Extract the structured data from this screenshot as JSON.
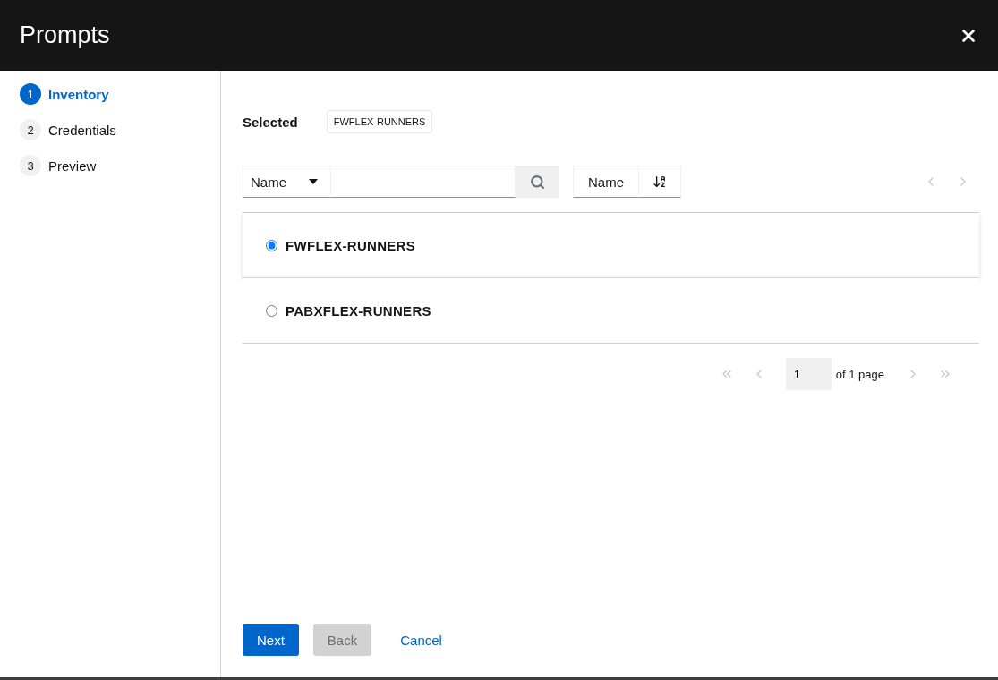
{
  "header": {
    "title": "Prompts"
  },
  "steps": [
    {
      "number": "1",
      "label": "Inventory",
      "selected": true
    },
    {
      "number": "2",
      "label": "Credentials",
      "selected": false
    },
    {
      "number": "3",
      "label": "Preview",
      "selected": false
    }
  ],
  "selected_chips": {
    "label": "Selected",
    "chips": [
      "FWFLEX-RUNNERS"
    ]
  },
  "toolbar": {
    "filter_by": "Name",
    "sort_by": "Name",
    "prev_disabled": true,
    "next_disabled": true
  },
  "rows": [
    {
      "label": "FWFLEX-RUNNERS",
      "selected": true
    },
    {
      "label": "PABXFLEX-RUNNERS",
      "selected": false
    }
  ],
  "pagination": {
    "page": "1",
    "of_text": "of 1 page",
    "first_disabled": true,
    "prev_disabled": true,
    "next_disabled": true,
    "last_disabled": true
  },
  "footer_buttons": [
    {
      "kind": "primary",
      "label": "Next",
      "disabled": false
    },
    {
      "kind": "secondary",
      "label": "Back",
      "disabled": true
    },
    {
      "kind": "link",
      "label": "Cancel",
      "disabled": false
    }
  ]
}
